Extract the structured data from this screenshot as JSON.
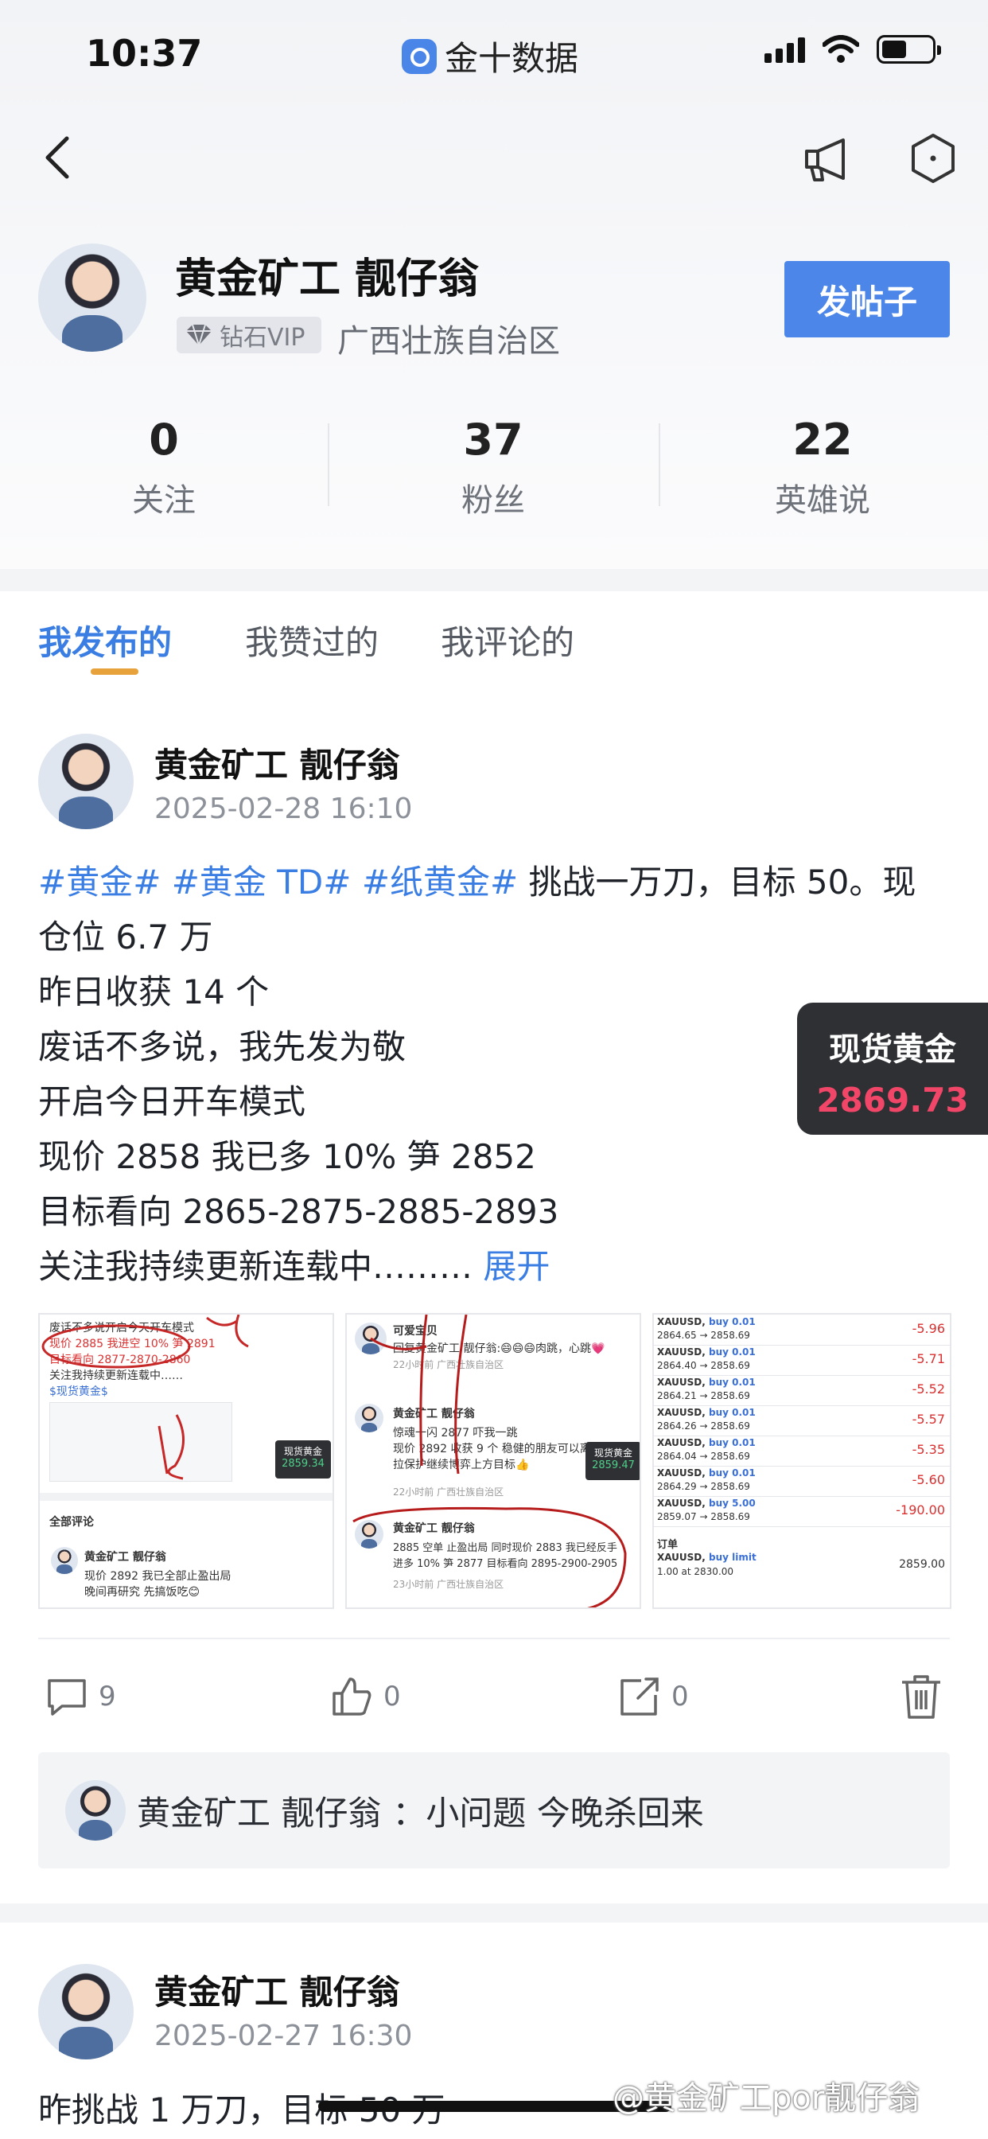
{
  "status_bar": {
    "time": "10:37",
    "app": "金十数据"
  },
  "profile": {
    "name": "黄金矿工 靓仔翁",
    "badge": "钻石VIP",
    "region": "广西壮族自治区",
    "post_button": "发帖子",
    "stats": [
      {
        "value": "0",
        "label": "关注"
      },
      {
        "value": "37",
        "label": "粉丝"
      },
      {
        "value": "22",
        "label": "英雄说"
      }
    ]
  },
  "tabs": [
    {
      "label": "我发布的",
      "active": true
    },
    {
      "label": "我赞过的",
      "active": false
    },
    {
      "label": "我评论的",
      "active": false
    }
  ],
  "post1": {
    "author": "黄金矿工 靓仔翁",
    "time": "2025-02-28 16:10",
    "tags": "#黄金# #黄金 TD# #纸黄金#",
    "line1_rest": " 挑战一万刀，目标 50。现",
    "lines": [
      "仓位 6.7 万",
      "昨日收获 14 个",
      "废话不多说，我先发为敬",
      "开启今日开车模式",
      "现价 2858 我已多 10% 笋 2852",
      "目标看向 2865-2875-2885-2893"
    ],
    "last_line": "关注我持续更新连载中……… ",
    "expand": "展开",
    "actions": {
      "comments": "9",
      "likes": "0",
      "shares": "0"
    },
    "top_comment": {
      "author": "黄金矿工 靓仔翁",
      "text": "：小问题  今晚杀回来"
    },
    "thumb1": {
      "lines": [
        "废话不多说开启今天开车模式",
        "现价 2885 我进空 10% 笋 2891",
        "目标看向 2877-2870-2860",
        "关注我持续更新连载中……",
        "$现货黄金$"
      ],
      "badge_label": "现货黄金",
      "badge_value": "2859.34",
      "section": "全部评论",
      "comment_author": "黄金矿工 靓仔翁",
      "comment_lines": [
        "现价 2892 我已全部止盈出局",
        "晚间再研究 先搞饭吃😊"
      ]
    },
    "thumb2": {
      "title": "可爱宝贝",
      "reply": "回复黄金矿工 靓仔翁:😄😄😄肉跳，心跳💗",
      "time1": "22小时前 广西壮族自治区",
      "author1": "黄金矿工 靓仔翁",
      "text1": [
        "惊魂一闪 2877 吓我一跳",
        "现价 2892 收获 9 个  稳健的朋友可以离场",
        "拉保护继续博弈上方目标👍"
      ],
      "badge_label": "现货黄金",
      "badge_value": "2859.47",
      "time2": "22小时前 广西壮族自治区",
      "author2": "黄金矿工 靓仔翁",
      "text2": [
        "2885 空单 止盈出局  同时现价 2883 我已经反手",
        "进多 10% 笋 2877  目标看向 2895-2900-2905"
      ],
      "time3": "23小时前 广西壮族自治区"
    },
    "thumb3": {
      "rows": [
        {
          "sym": "XAUUSD",
          "side": "buy 0.01",
          "path": "2864.65 → 2858.69",
          "pnl": "-5.96"
        },
        {
          "sym": "XAUUSD",
          "side": "buy 0.01",
          "path": "2864.40 → 2858.69",
          "pnl": "-5.71"
        },
        {
          "sym": "XAUUSD",
          "side": "buy 0.01",
          "path": "2864.21 → 2858.69",
          "pnl": "-5.52"
        },
        {
          "sym": "XAUUSD",
          "side": "buy 0.01",
          "path": "2864.26 → 2858.69",
          "pnl": "-5.57"
        },
        {
          "sym": "XAUUSD",
          "side": "buy 0.01",
          "path": "2864.04 → 2858.69",
          "pnl": "-5.35"
        },
        {
          "sym": "XAUUSD",
          "side": "buy 0.01",
          "path": "2864.29 → 2858.69",
          "pnl": "-5.60"
        },
        {
          "sym": "XAUUSD",
          "side": "buy 5.00",
          "path": "2859.07 → 2858.69",
          "pnl": "-190.00"
        }
      ],
      "orders_label": "订单",
      "order": {
        "sym": "XAUUSD",
        "side": "buy limit",
        "detail": "1.00 at 2830.00",
        "price": "2859.00"
      }
    }
  },
  "price_widget": {
    "label": "现货黄金",
    "value": "2869.73"
  },
  "post2": {
    "author": "黄金矿工 靓仔翁",
    "time": "2025-02-27 16:30",
    "text": "昨挑战 1 万刀，目标 50 万"
  },
  "watermark": "@黄金矿工por靓仔翁"
}
